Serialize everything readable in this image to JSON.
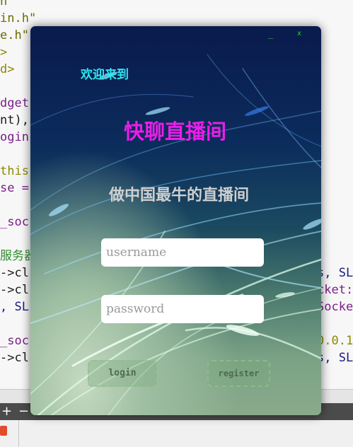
{
  "editor": {
    "lines": [
      {
        "id": "l1",
        "text": "h\""
      },
      {
        "id": "l2",
        "text": "in.h\""
      },
      {
        "id": "l3",
        "text": "e.h\""
      },
      {
        "id": "l4",
        "text": ">"
      },
      {
        "id": "l5",
        "text": "d>"
      },
      {
        "id": "l6",
        "text": "dget"
      },
      {
        "id": "l7",
        "text": "nt),"
      },
      {
        "id": "l8",
        "text": "ogin"
      },
      {
        "id": "l9",
        "text": "this"
      },
      {
        "id": "l10",
        "text": "se ="
      },
      {
        "id": "l11",
        "text": "_soc"
      },
      {
        "id": "l12",
        "text": "服务器"
      },
      {
        "id": "l13",
        "text": "->cl"
      },
      {
        "id": "l14",
        "text": "->cl"
      },
      {
        "id": "l15",
        "text": ", SL"
      },
      {
        "id": "l16",
        "text": "_soc"
      },
      {
        "id": "l17",
        "text": "->cl"
      },
      {
        "id": "r1",
        "text": "s, SL"
      },
      {
        "id": "r2",
        "text": "cket:"
      },
      {
        "id": "r3",
        "text": "Socke"
      },
      {
        "id": "r4",
        "text": "0.0.1"
      },
      {
        "id": "r5",
        "text": "s, SL"
      }
    ]
  },
  "bottom": {
    "plus": "+",
    "minus": "−"
  },
  "window": {
    "minimize": "_",
    "close": "x",
    "welcome": "欢迎来到",
    "room_title": "快聊直播间",
    "slogan": "做中国最牛的直播间",
    "username_placeholder": "username",
    "password_placeholder": "password",
    "login_label": "login",
    "register_label": "register"
  },
  "colors": {
    "welcome": "#2fe6f0",
    "title": "#ea1ee8",
    "slogan": "#cfcfcf",
    "window_controls": "#35d635"
  }
}
